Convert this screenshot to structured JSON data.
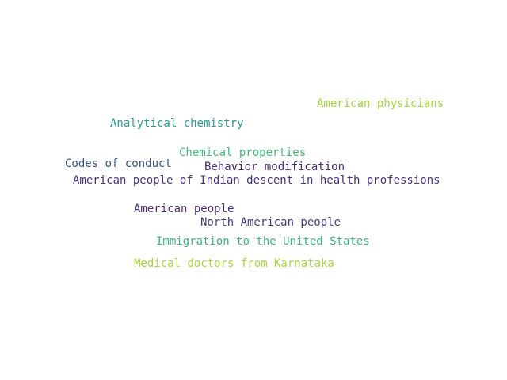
{
  "words": [
    {
      "text": "American physicians",
      "color": "#a0da39"
    },
    {
      "text": "Analytical chemistry",
      "color": "#2a9d8f"
    },
    {
      "text": "Chemical properties",
      "color": "#3dbc74"
    },
    {
      "text": "Codes of conduct",
      "color": "#3b528b"
    },
    {
      "text": "Behavior modification",
      "color": "#482878"
    },
    {
      "text": "American people of Indian descent in health professions",
      "color": "#46327e"
    },
    {
      "text": "American people",
      "color": "#472d7b"
    },
    {
      "text": "North American people",
      "color": "#443a83"
    },
    {
      "text": "Immigration to the United States",
      "color": "#35b779"
    },
    {
      "text": "Medical doctors from Karnataka",
      "color": "#a5db36"
    }
  ]
}
